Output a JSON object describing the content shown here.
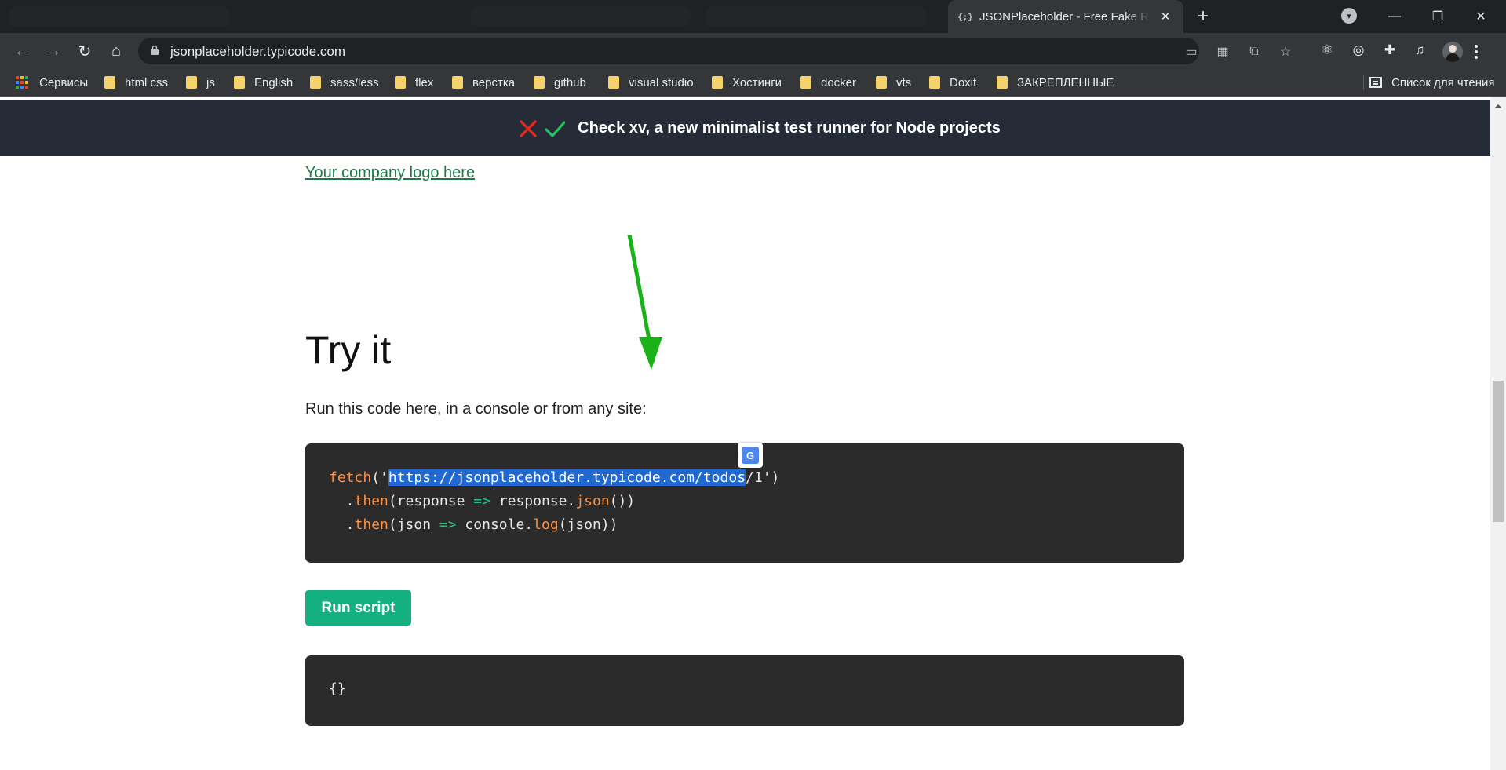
{
  "browser": {
    "tab_title": "JSONPlaceholder - Free Fake REST API",
    "tab_favicon": "{;}",
    "new_tab": "+",
    "url": "jsonplaceholder.typicode.com",
    "profile_initial": "",
    "icons": {
      "back": "arrow-left-icon",
      "forward": "arrow-right-icon",
      "reload": "reload-icon",
      "home": "home-icon",
      "star": "star-icon",
      "extensions": "puzzle-icon"
    }
  },
  "bookmarks": {
    "apps_label": "Сервисы",
    "items": [
      {
        "label": "html css"
      },
      {
        "label": "js"
      },
      {
        "label": "English"
      },
      {
        "label": "sass/less"
      },
      {
        "label": "flex"
      },
      {
        "label": "верстка"
      },
      {
        "label": "github"
      },
      {
        "label": "visual studio"
      },
      {
        "label": "Хостинги"
      },
      {
        "label": "docker"
      },
      {
        "label": "vts"
      },
      {
        "label": "Doxit"
      },
      {
        "label": "ЗАКРЕПЛЕННЫЕ"
      }
    ],
    "reading_list": "Список для чтения"
  },
  "page": {
    "banner_text": "Check xv, a new minimalist test runner for Node projects",
    "sponsor_link": "Your company logo here",
    "heading": "Try it",
    "lead": "Run this code here, in a console or from any site:",
    "code": {
      "l1_fn": "fetch",
      "l1_open": "('",
      "l1_selected": "https://jsonplaceholder.typicode.com/todos",
      "l1_rest": "/1'",
      "l1_close": ")",
      "l2_indent": "  .",
      "l2_then": "then",
      "l2_mid": "(response ",
      "l2_arrow": "=>",
      "l2_resp": " response.",
      "l2_json": "json",
      "l2_end": "())",
      "l3_indent": "  .",
      "l3_then": "then",
      "l3_mid": "(json ",
      "l3_arrow": "=>",
      "l3_console": " console.",
      "l3_log": "log",
      "l3_end": "(json))"
    },
    "run_button": "Run script",
    "result": "{}",
    "translate_badge": "G"
  },
  "colors": {
    "banner_bg": "#252c37",
    "code_bg": "#2b2b2b",
    "run_button": "#14b07f",
    "selection": "#2168d3",
    "annotation_arrow": "#19b319"
  }
}
